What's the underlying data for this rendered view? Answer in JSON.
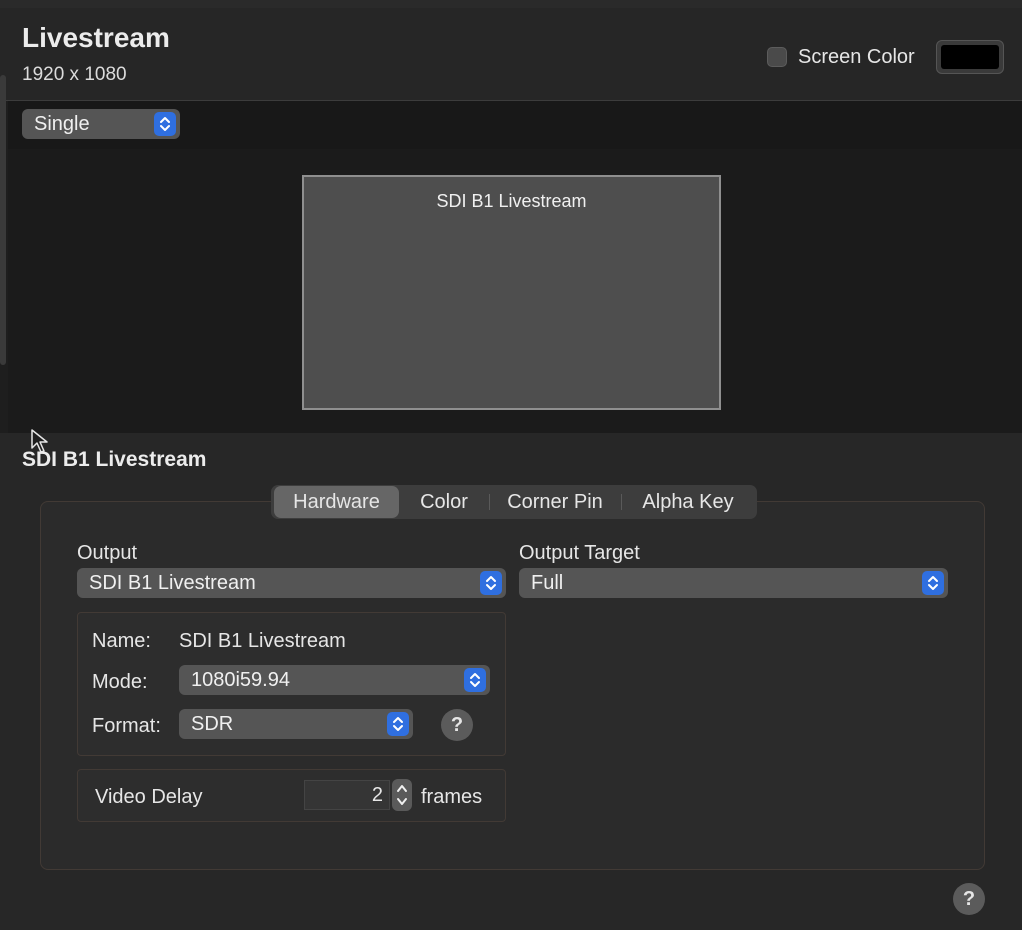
{
  "header": {
    "title": "Livestream",
    "resolution": "1920 x 1080",
    "screen_color_label": "Screen Color",
    "screen_color_checked": false,
    "screen_color_value": "#000000"
  },
  "layout_selector": {
    "value": "Single"
  },
  "preview": {
    "screen_label": "SDI B1 Livestream"
  },
  "section": {
    "title": "SDI B1 Livestream"
  },
  "tabs": [
    {
      "label": "Hardware",
      "active": true
    },
    {
      "label": "Color",
      "active": false
    },
    {
      "label": "Corner Pin",
      "active": false
    },
    {
      "label": "Alpha Key",
      "active": false
    }
  ],
  "hardware": {
    "output_label": "Output",
    "output_value": "SDI B1 Livestream",
    "output_target_label": "Output Target",
    "output_target_value": "Full",
    "name_label": "Name:",
    "name_value": "SDI B1 Livestream",
    "mode_label": "Mode:",
    "mode_value": "1080i59.94",
    "format_label": "Format:",
    "format_value": "SDR",
    "help_glyph": "?",
    "video_delay_label": "Video Delay",
    "video_delay_value": "2",
    "video_delay_unit": "frames"
  },
  "footer": {
    "help_glyph": "?"
  },
  "colors": {
    "accent": "#2f6fe0",
    "background": "#1e1e1e"
  }
}
